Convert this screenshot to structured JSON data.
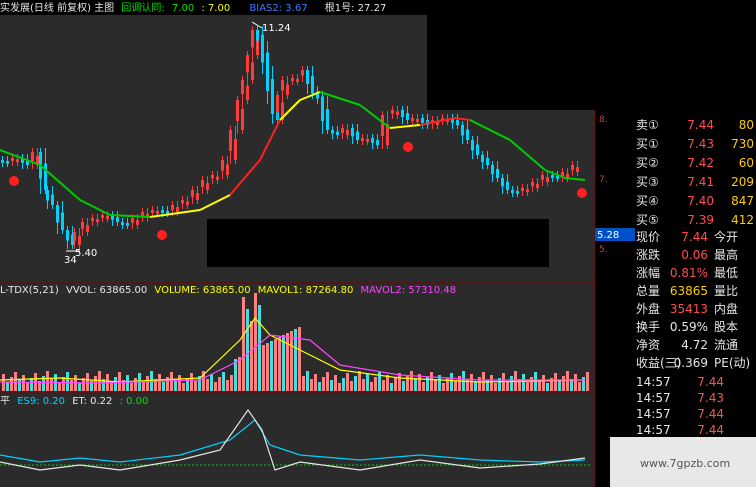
{
  "header": {
    "title": "实发展(日线 前复权) 主图",
    "indicator_name": "回调认同:",
    "indicator_v1": "7.00",
    "indicator_v2": ": 7.00",
    "bias_label": "BIAS2: 3.67",
    "gen_label": "根1号: 27.27"
  },
  "price_annotations": {
    "high": "11.24",
    "low": "5.40",
    "low2": "34",
    "current_tag": "5.28"
  },
  "volume_legend": {
    "name": "L-TDX(5,21)",
    "vvol": "VVOL: 63865.00",
    "volume": "VOLUME: 63865.00",
    "mavol1": "MAVOL1: 87264.80",
    "mavol2": "MAVOL2: 57310.48"
  },
  "es_legend": {
    "prefix": "平",
    "es9": "ES9: 0.20",
    "et": "ET: 0.22",
    "last": ": 0.00"
  },
  "order_book": [
    {
      "label": "卖①",
      "price": "7.44",
      "qty": "80"
    },
    {
      "label": "买①",
      "price": "7.43",
      "qty": "730"
    },
    {
      "label": "买②",
      "price": "7.42",
      "qty": "60"
    },
    {
      "label": "买③",
      "price": "7.41",
      "qty": "209"
    },
    {
      "label": "买④",
      "price": "7.40",
      "qty": "847"
    },
    {
      "label": "买⑤",
      "price": "7.39",
      "qty": "412"
    }
  ],
  "quote": [
    {
      "label": "现价",
      "value": "7.44",
      "label2": "今开",
      "color": "#ff4d4d"
    },
    {
      "label": "涨跌",
      "value": "0.06",
      "label2": "最高",
      "color": "#ff4d4d"
    },
    {
      "label": "涨幅",
      "value": "0.81%",
      "label2": "最低",
      "color": "#ff4d4d"
    },
    {
      "label": "总量",
      "value": "63865",
      "label2": "量比",
      "color": "#ffcc00"
    },
    {
      "label": "外盘",
      "value": "35413",
      "label2": "内盘",
      "color": "#ff4d4d"
    }
  ],
  "fundamentals": [
    {
      "label": "换手",
      "value": "0.59%",
      "label2": "股本"
    },
    {
      "label": "净资",
      "value": "4.72",
      "label2": "流通"
    },
    {
      "label": "收益(三)",
      "value": "0.369",
      "label2": "PE(动)"
    }
  ],
  "ticks": [
    {
      "time": "14:57",
      "price": "7.44"
    },
    {
      "time": "14:57",
      "price": "7.43"
    },
    {
      "time": "14:57",
      "price": "7.44"
    },
    {
      "time": "14:57",
      "price": "7.44"
    }
  ],
  "watermark": "www.7gpzb.com",
  "colors": {
    "up": "#ff3b3b",
    "down": "#00d2ff",
    "ma_green": "#00cc00",
    "ma_yellow": "#ffff00",
    "ma_red": "#ff2020",
    "mavol1": "#ffff00",
    "mavol2": "#ff44ff"
  }
}
